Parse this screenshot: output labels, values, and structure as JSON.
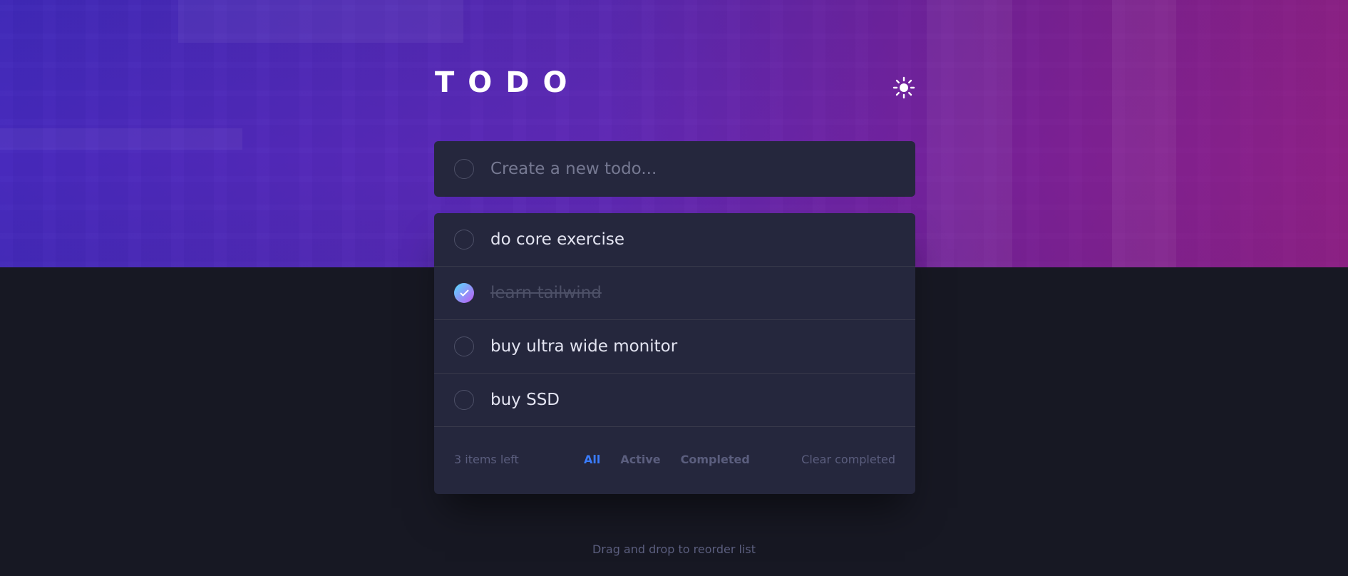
{
  "header": {
    "title": "TODO",
    "theme_toggle_icon": "sun-icon"
  },
  "new_todo": {
    "placeholder": "Create a new todo...",
    "value": ""
  },
  "todos": [
    {
      "text": "do core exercise",
      "completed": false
    },
    {
      "text": "learn tailwind",
      "completed": true
    },
    {
      "text": "buy ultra wide monitor",
      "completed": false
    },
    {
      "text": "buy SSD",
      "completed": false
    }
  ],
  "footer": {
    "items_left": "3 items left",
    "filters": [
      "All",
      "Active",
      "Completed"
    ],
    "active_filter": "All",
    "clear_label": "Clear completed"
  },
  "hint": "Drag and drop to reorder list",
  "colors": {
    "background": "#171823",
    "card": "#25273d",
    "accent": "#3a7cfd",
    "check_gradient_start": "#55ddff",
    "check_gradient_end": "#c058f3"
  }
}
